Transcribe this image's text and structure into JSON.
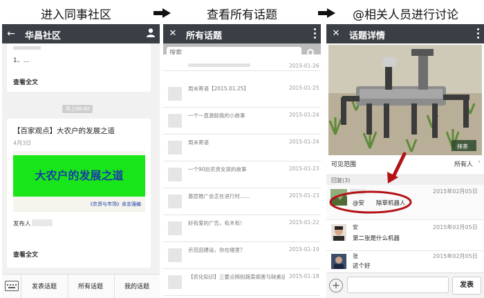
{
  "captions": {
    "step1": "进入同事社区",
    "step2": "查看所有话题",
    "step3": "@相关人员进行讨论"
  },
  "colors": {
    "topbar": "#3a3f45",
    "banner_bg": "#19e619",
    "banner_text": "#1a3aa8",
    "annotation": "#b31217"
  },
  "phone1": {
    "title": "华昌社区",
    "snippet_line1": "1、...",
    "read_all_1": "查看全文",
    "time_badge": "早上08:40",
    "post_title": "【百家观点】大农户的发展之道",
    "post_date": "4月3日",
    "banner_text": "大农户的发展之道",
    "banner_sub": "《农资与市场》余志强编",
    "publisher_label": "发布人",
    "read_all_2": "查看全文",
    "bottom_nav": [
      "发表话题",
      "所有话题",
      "我的话题"
    ]
  },
  "phone2": {
    "title": "所有话题",
    "search_placeholder": "搜索",
    "topics": [
      {
        "title": "",
        "date": "2015-01-26"
      },
      {
        "title": "周末寄语【2015.01.25】",
        "date": "2015-01-25"
      },
      {
        "title": "一个一直激励我的小故事",
        "date": "2015-01-24"
      },
      {
        "title": "周末寄语",
        "date": "2015-01-24"
      },
      {
        "title": "一个90后农资女孩的故事",
        "date": "2015-01-23"
      },
      {
        "title": "基层推广会正在进行时……",
        "date": "2015-01-23"
      },
      {
        "title": "好有爱的广告，有木有！",
        "date": "2015-01-22"
      },
      {
        "title": "示范田建设，你在哪里？",
        "date": "2015-01-19"
      },
      {
        "title": "【农化知识】三要点辨别蔬菜病害与缺素症",
        "date": "2015-01-18"
      }
    ]
  },
  "phone3": {
    "title": "话题详情",
    "photo_watermark": "抹茶",
    "visibility_label": "可见范围",
    "visibility_value": "所有人",
    "replies_label": "回复(3)",
    "replies": [
      {
        "name": "",
        "text": "@安　　除草机器人",
        "date": "2015年02月05日"
      },
      {
        "name": "安",
        "text": "第二张是什么机器",
        "date": "2015年02月05日"
      },
      {
        "name": "张",
        "text": "这个好",
        "date": "2015年02月05日"
      }
    ],
    "send_label": "发表",
    "plus_label": "+"
  }
}
